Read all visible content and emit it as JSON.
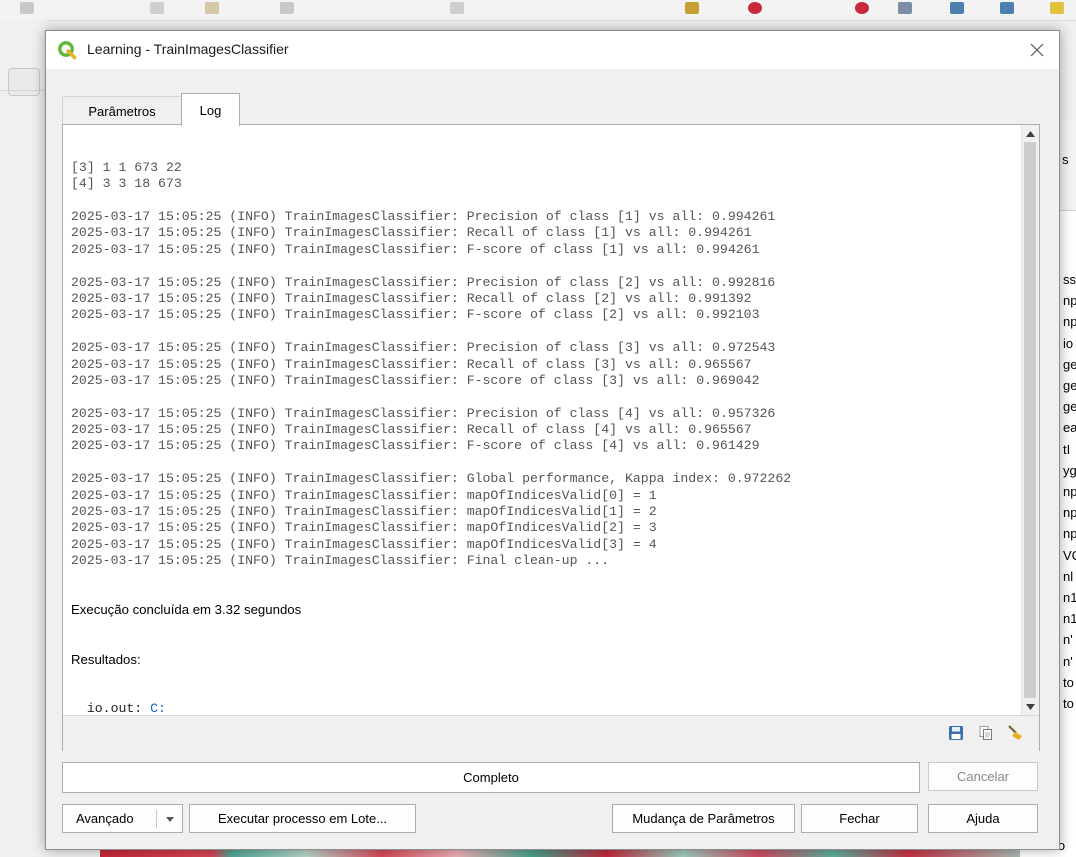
{
  "background": {
    "right_panel_items": [
      "ss",
      "np",
      "np",
      "io",
      "ge",
      "ge",
      "ge",
      "ea",
      "tI",
      "yg",
      "np",
      "np",
      "np",
      "VC",
      "nl",
      "n1",
      "n1",
      "n'",
      "n'",
      "to",
      "to"
    ],
    "right_panel_top_label": "s",
    "map_label": "vecto"
  },
  "dialog": {
    "title": "Learning - TrainImagesClassifier",
    "tabs": [
      {
        "label": "Parâmetros",
        "active": false
      },
      {
        "label": "Log",
        "active": true
      }
    ],
    "log_lines": [
      "[3] 1 1 673 22",
      "[4] 3 3 18 673",
      "",
      "2025-03-17 15:05:25 (INFO) TrainImagesClassifier: Precision of class [1] vs all: 0.994261",
      "2025-03-17 15:05:25 (INFO) TrainImagesClassifier: Recall of class [1] vs all: 0.994261",
      "2025-03-17 15:05:25 (INFO) TrainImagesClassifier: F-score of class [1] vs all: 0.994261",
      "",
      "2025-03-17 15:05:25 (INFO) TrainImagesClassifier: Precision of class [2] vs all: 0.992816",
      "2025-03-17 15:05:25 (INFO) TrainImagesClassifier: Recall of class [2] vs all: 0.991392",
      "2025-03-17 15:05:25 (INFO) TrainImagesClassifier: F-score of class [2] vs all: 0.992103",
      "",
      "2025-03-17 15:05:25 (INFO) TrainImagesClassifier: Precision of class [3] vs all: 0.972543",
      "2025-03-17 15:05:25 (INFO) TrainImagesClassifier: Recall of class [3] vs all: 0.965567",
      "2025-03-17 15:05:25 (INFO) TrainImagesClassifier: F-score of class [3] vs all: 0.969042",
      "",
      "2025-03-17 15:05:25 (INFO) TrainImagesClassifier: Precision of class [4] vs all: 0.957326",
      "2025-03-17 15:05:25 (INFO) TrainImagesClassifier: Recall of class [4] vs all: 0.965567",
      "2025-03-17 15:05:25 (INFO) TrainImagesClassifier: F-score of class [4] vs all: 0.961429",
      "",
      "2025-03-17 15:05:25 (INFO) TrainImagesClassifier: Global performance, Kappa index: 0.972262",
      "2025-03-17 15:05:25 (INFO) TrainImagesClassifier: mapOfIndicesValid[0] = 1",
      "2025-03-17 15:05:25 (INFO) TrainImagesClassifier: mapOfIndicesValid[1] = 2",
      "2025-03-17 15:05:25 (INFO) TrainImagesClassifier: mapOfIndicesValid[2] = 3",
      "2025-03-17 15:05:25 (INFO) TrainImagesClassifier: mapOfIndicesValid[3] = 4",
      "2025-03-17 15:05:25 (INFO) TrainImagesClassifier: Final clean-up ..."
    ],
    "summary_lines": [
      "Execução concluída em 3.32 segundos",
      "Resultados:"
    ],
    "cut_line": {
      "prefix": "  io.out: ",
      "link": "C:"
    },
    "progress_text": "Completo",
    "progress_fraction": 1.0,
    "buttons": {
      "cancel": "Cancelar",
      "advanced": "Avançado",
      "batch": "Executar processo em Lote...",
      "change_params": "Mudança de Parâmetros",
      "close": "Fechar",
      "help": "Ajuda"
    },
    "footer_icons": [
      "save-icon",
      "copy-icon",
      "clear-icon"
    ],
    "colors": {
      "logo_green": "#5fb83b",
      "link_blue": "#1a5fd0",
      "log_text": "#555555"
    }
  }
}
